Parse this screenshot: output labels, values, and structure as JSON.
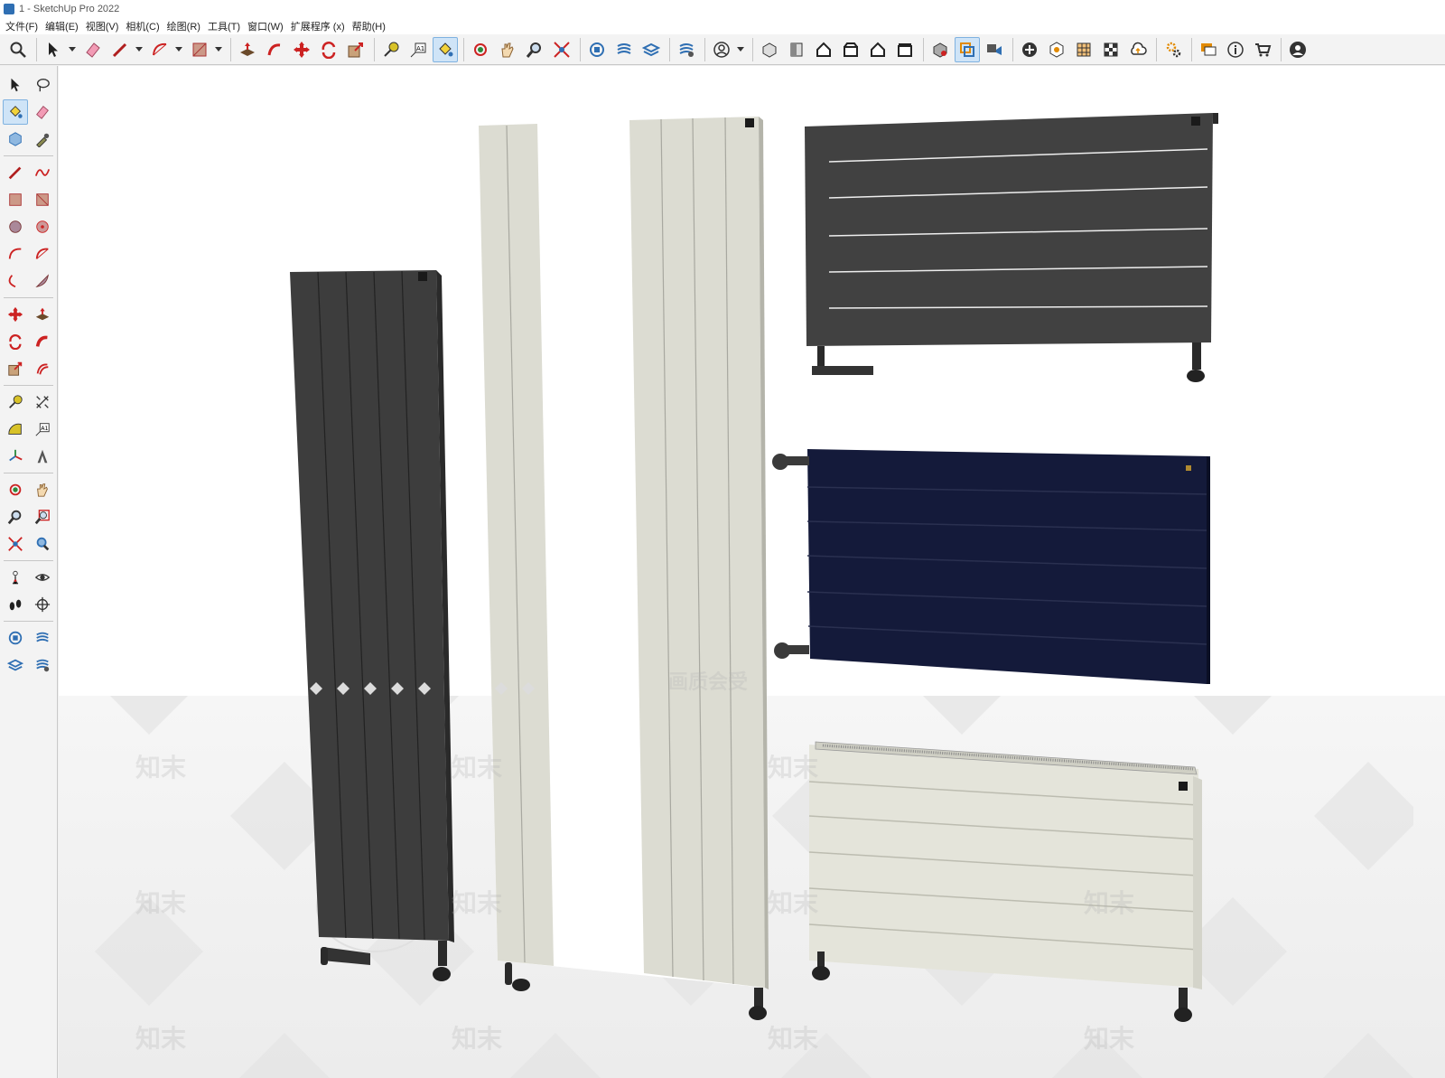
{
  "window": {
    "title": "1 - SketchUp Pro 2022"
  },
  "menu": [
    "文件(F)",
    "编辑(E)",
    "视图(V)",
    "相机(C)",
    "绘图(R)",
    "工具(T)",
    "窗口(W)",
    "扩展程序 (x)",
    "帮助(H)"
  ],
  "toolbar": {
    "icons": [
      "search-icon",
      "select-icon",
      "eraser-icon",
      "pencil-icon",
      "arc-icon",
      "rectangle-icon",
      "push-pull-icon",
      "follow-me-icon",
      "move-icon",
      "rotate-icon",
      "scale-icon",
      "tape-measure-icon",
      "text-icon",
      "paint-bucket-icon",
      "orbit-icon",
      "pan-icon",
      "zoom-icon",
      "zoom-extents-icon",
      "warehouse-icon",
      "extension-warehouse-icon",
      "layout-icon",
      "style-builder-icon",
      "user-icon",
      "iso-view-icon",
      "top-view-icon",
      "front-view-icon",
      "right-view-icon",
      "back-view-icon",
      "left-view-icon",
      "solid-tools-icon",
      "outer-shell-icon",
      "intersect-icon",
      "add-location-icon",
      "sandbox-icon",
      "texture-icon",
      "checker-icon",
      "cloud-icon",
      "settings-icon",
      "comment-icon",
      "info-icon",
      "cart-icon",
      "account-icon"
    ],
    "active": "paint-bucket-icon"
  },
  "accent": "#2f6fb3",
  "watermark": {
    "text": "知末",
    "subtext": "画质会受"
  },
  "colors": {
    "dark_radiator": "#3d3d3d",
    "light_radiator": "#dcdcd2",
    "navy_radiator": "#141a3a",
    "grey_radiator": "#414141"
  }
}
